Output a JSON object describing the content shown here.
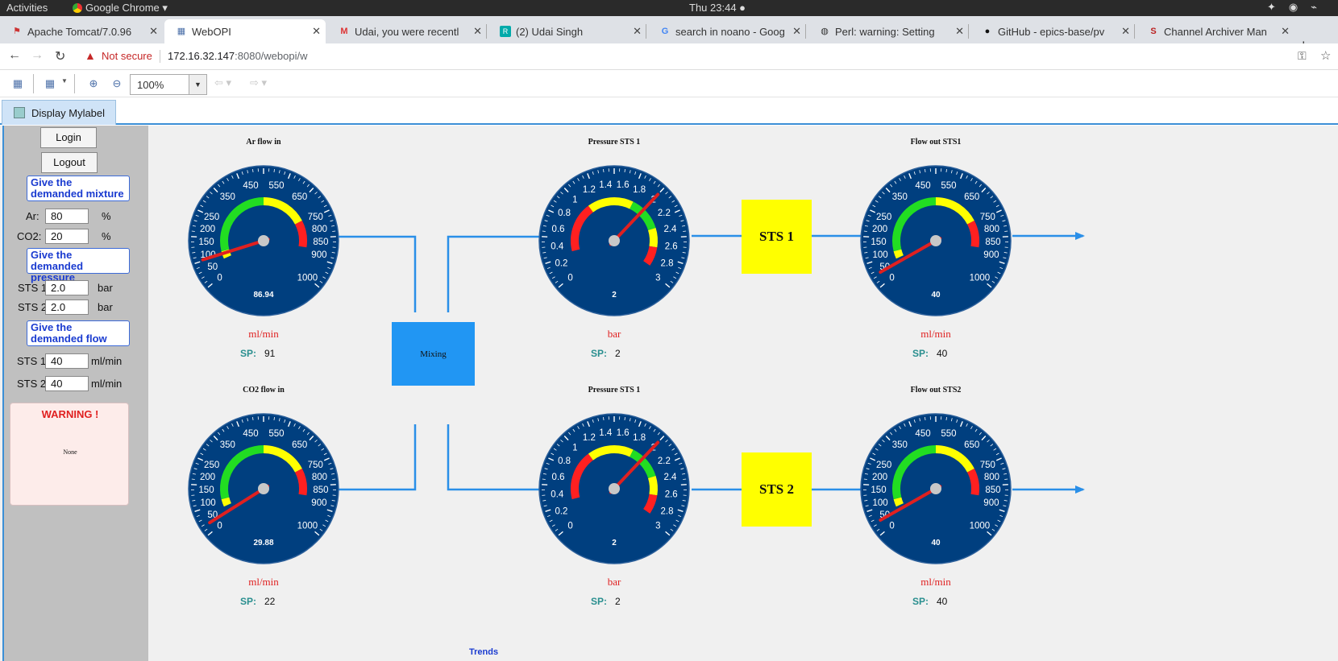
{
  "os": {
    "activities": "Activities",
    "app_name": "Google Chrome ▾",
    "clock": "Thu 23:44 ●"
  },
  "browser": {
    "tabs": [
      {
        "title": "Apache Tomcat/7.0.96",
        "icon": "tomcat-icon"
      },
      {
        "title": "WebOPI",
        "icon": "webopi-icon",
        "active": true
      },
      {
        "title": "Udai, you were recentl",
        "icon": "gmail-icon"
      },
      {
        "title": "(2) Udai Singh",
        "icon": "researchgate-icon"
      },
      {
        "title": "search in noano - Goog",
        "icon": "google-icon"
      },
      {
        "title": "Perl: warning: Setting",
        "icon": "perl-icon"
      },
      {
        "title": "GitHub - epics-base/pv",
        "icon": "github-icon"
      },
      {
        "title": "Channel Archiver Man",
        "icon": "slac-icon"
      }
    ],
    "not_secure": "Not secure",
    "url_host": "172.16.32.147",
    "url_rest": ":8080/webopi/w"
  },
  "toolbar": {
    "zoom": "100%"
  },
  "display_tab": {
    "label": "Display Mylabel"
  },
  "panel": {
    "login": "Login",
    "logout": "Logout",
    "mixture_header": "Give the demanded mixture",
    "ar_label": "Ar:",
    "ar_value": "80",
    "co2_label": "CO2:",
    "co2_value": "20",
    "percent": "%",
    "pressure_header": "Give the demanded pressure",
    "sts1_label": "STS 1",
    "sts2_label": "STS 2",
    "p_sts1": "2.0",
    "p_sts2": "2.0",
    "bar_unit": "bar",
    "flow_header": "Give the demanded flow",
    "f_sts1": "40",
    "f_sts2": "40",
    "flow_unit": "ml/min",
    "warning_title": "WARNING !",
    "warning_text": "None"
  },
  "gauges": [
    {
      "id": "ar",
      "title": "Ar flow in",
      "unit": "ml/min",
      "sp_label": "SP:",
      "sp": "91",
      "value": 86.94,
      "readout": "86.94",
      "ticks": [
        "0",
        "50",
        "100",
        "150",
        "200",
        "250",
        "350",
        "450",
        "550",
        "650",
        "750",
        "800",
        "850",
        "900",
        "1000"
      ]
    },
    {
      "id": "p1",
      "title": "Pressure STS 1",
      "unit": "bar",
      "sp_label": "SP:",
      "sp": "2",
      "value": 2,
      "readout": "2",
      "ticks": [
        "0",
        "0.2",
        "0.4",
        "0.6",
        "0.8",
        "1",
        "1.2",
        "1.4",
        "1.6",
        "1.8",
        "2",
        "2.2",
        "2.4",
        "2.6",
        "2.8",
        "3"
      ]
    },
    {
      "id": "f1",
      "title": "Flow out STS1",
      "unit": "ml/min",
      "sp_label": "SP:",
      "sp": "40",
      "value": 40,
      "readout": "40",
      "ticks": [
        "0",
        "50",
        "100",
        "150",
        "200",
        "250",
        "350",
        "450",
        "550",
        "650",
        "750",
        "800",
        "850",
        "900",
        "1000"
      ]
    },
    {
      "id": "co2",
      "title": "CO2 flow in",
      "unit": "ml/min",
      "sp_label": "SP:",
      "sp": "22",
      "value": 29.88,
      "readout": "29.88",
      "ticks": [
        "0",
        "50",
        "100",
        "150",
        "200",
        "250",
        "350",
        "450",
        "550",
        "650",
        "750",
        "800",
        "850",
        "900",
        "1000"
      ]
    },
    {
      "id": "p2",
      "title": "Pressure STS 1",
      "unit": "bar",
      "sp_label": "SP:",
      "sp": "2",
      "value": 2,
      "readout": "2",
      "ticks": [
        "0",
        "0.2",
        "0.4",
        "0.6",
        "0.8",
        "1",
        "1.2",
        "1.4",
        "1.6",
        "1.8",
        "2",
        "2.2",
        "2.4",
        "2.6",
        "2.8",
        "3"
      ]
    },
    {
      "id": "f2",
      "title": "Flow out STS2",
      "unit": "ml/min",
      "sp_label": "SP:",
      "sp": "40",
      "value": 40,
      "readout": "40",
      "ticks": [
        "0",
        "50",
        "100",
        "150",
        "200",
        "250",
        "350",
        "450",
        "550",
        "650",
        "750",
        "800",
        "850",
        "900",
        "1000"
      ]
    }
  ],
  "diagram": {
    "mixing": "Mixing",
    "sts1": "STS 1",
    "sts2": "STS 2",
    "trends": "Trends"
  },
  "colors": {
    "gauge_face": "#003f7f",
    "pipe": "#2a8fe8",
    "mixing_box": "#2196f3",
    "sts_box": "#ffff00",
    "needle": "#e02020"
  }
}
